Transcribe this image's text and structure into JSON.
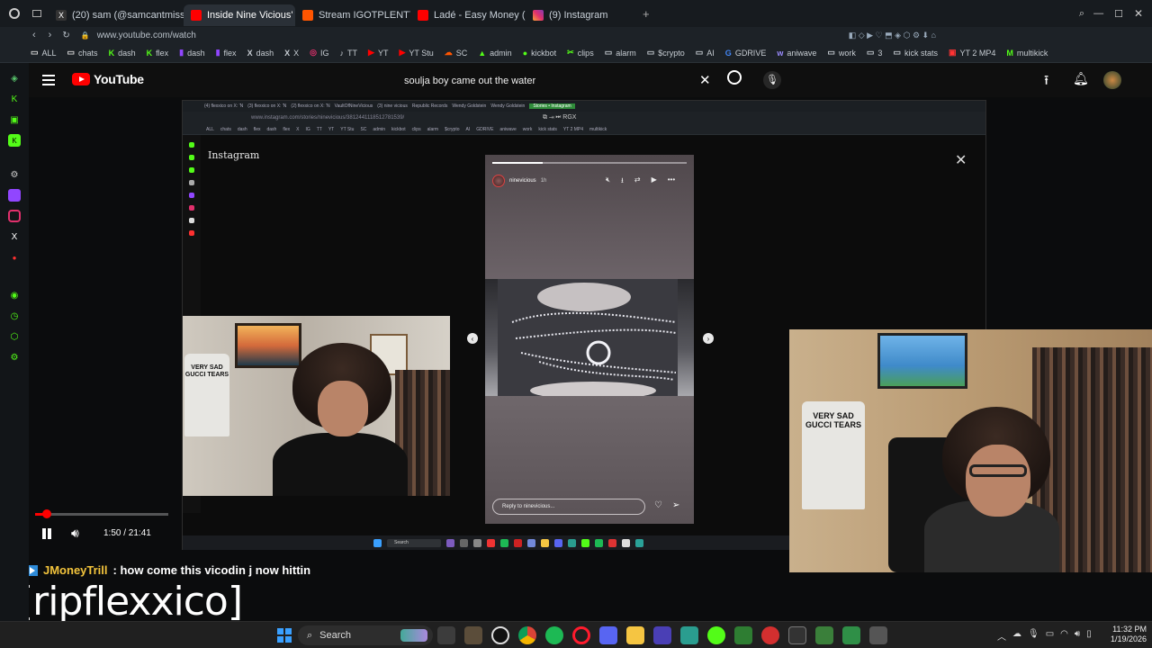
{
  "browser": {
    "tabs": [
      {
        "label": "(20) sam (@samcantmiss",
        "color": "#e8e8e8",
        "active": false
      },
      {
        "label": "Inside Nine Vicious' N",
        "color": "#ff0000",
        "active": true
      },
      {
        "label": "Stream IGOTPLENTYDICK",
        "color": "#ff5500",
        "active": false
      },
      {
        "label": "Ladé - Easy Money (Offic",
        "color": "#ff0000",
        "active": false
      },
      {
        "label": "(9) Instagram",
        "color": "#e1306c",
        "active": false
      }
    ],
    "url": "www.youtube.com/watch",
    "bookmarks": [
      "ALL",
      "chats",
      "dash",
      "flex",
      "dash",
      "flex",
      "dash",
      "X",
      "IG",
      "TT",
      "YT",
      "YT Stu",
      "SC",
      "admin",
      "kickbot",
      "clips",
      "alarm",
      "$crypto",
      "AI",
      "GDRIVE",
      "aniwave",
      "work",
      "3",
      "kick stats",
      "YT 2 MP4",
      "multikick"
    ]
  },
  "youtube": {
    "logo": "YouTube",
    "search_value": "soulja boy came out the water"
  },
  "inner_screen": {
    "url": "www.instagram.com/stories/ninevicious/3812441118512781539/",
    "tabs": [
      "(4) flexxico on X: 'N",
      "(3) flexxico on X: 'N",
      "(2) flexxico on X: 'N",
      "VaultOfNineVicious",
      "(3) nine vicious",
      "Republic Records",
      "Wendy Goldstein",
      "Wendy Goldstein",
      "Stories • Instagram"
    ],
    "bookmarks": [
      "ALL",
      "chats",
      "dash",
      "flex",
      "dash",
      "flex",
      "X",
      "IG",
      "TT",
      "YT",
      "YT Stu",
      "SC",
      "admin",
      "kickbot",
      "clips",
      "alarm",
      "$crypto",
      "AI",
      "GDRIVE",
      "aniwave",
      "work",
      "kick stats",
      "YT 2 MP4",
      "multikick"
    ],
    "ig_brand": "Instagram",
    "story": {
      "username": "ninevicious",
      "time": "1h",
      "progress": 0.26,
      "reply_placeholder": "Reply to ninevicious..."
    },
    "taskbar_search": "Search"
  },
  "webcam_left": {
    "shirt_text": "VERY SAD GUCCI TEARS"
  },
  "webcam_right": {
    "shirt_text": "VERY SAD GUCCI TEARS"
  },
  "video_controls": {
    "time": "1:50 / 21:41",
    "progress": 0.0845
  },
  "chat": {
    "username": "JMoneyTrill",
    "message": ": how come this vicodin j now hittin"
  },
  "caption": "[ripflexxico]",
  "taskbar": {
    "search_label": "Search",
    "time": "11:32 PM",
    "date": "1/19/2026"
  }
}
